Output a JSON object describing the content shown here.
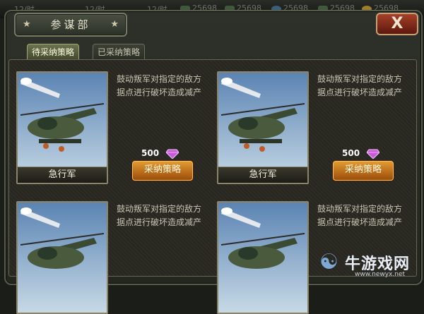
{
  "topbar": {
    "slots": [
      {
        "text": "12/时",
        "icon": "none"
      },
      {
        "text": "12/时",
        "icon": "none"
      },
      {
        "text": "12/时",
        "icon": "none"
      },
      {
        "text": "25698",
        "icon": "tank-icon"
      },
      {
        "text": "25698",
        "icon": "tank-icon"
      },
      {
        "text": "25698",
        "icon": "gem-icon"
      },
      {
        "text": "25698",
        "icon": "tank-icon"
      },
      {
        "text": "25698",
        "icon": "coin-icon"
      }
    ]
  },
  "dialog": {
    "title": "参谋部",
    "close_label": "X",
    "tabs": [
      {
        "label": "待采纳策略",
        "active": true
      },
      {
        "label": "已采纳策略",
        "active": false
      }
    ]
  },
  "strategies": [
    {
      "name": "急行军",
      "description": "鼓动叛军对指定的敌方据点进行破坏造成减产",
      "cost": "500",
      "button_label": "采纳策略",
      "currency_icon": "diamond-icon"
    },
    {
      "name": "急行军",
      "description": "鼓动叛军对指定的敌方据点进行破坏造成减产",
      "cost": "500",
      "button_label": "采纳策略",
      "currency_icon": "diamond-icon"
    },
    {
      "name": "",
      "description": "鼓动叛军对指定的敌方据点进行破坏造成减产",
      "cost": "",
      "button_label": "",
      "currency_icon": "diamond-icon"
    },
    {
      "name": "",
      "description": "鼓动叛军对指定的敌方据点进行破坏造成减产",
      "cost": "",
      "button_label": "",
      "currency_icon": "diamond-icon"
    }
  ],
  "watermark": {
    "logo_text": "牛游戏网",
    "url": "www.newyx.net"
  },
  "colors": {
    "accent_button": "#e29a31",
    "close_button": "#a5412a",
    "gem": "#c85ad8"
  }
}
